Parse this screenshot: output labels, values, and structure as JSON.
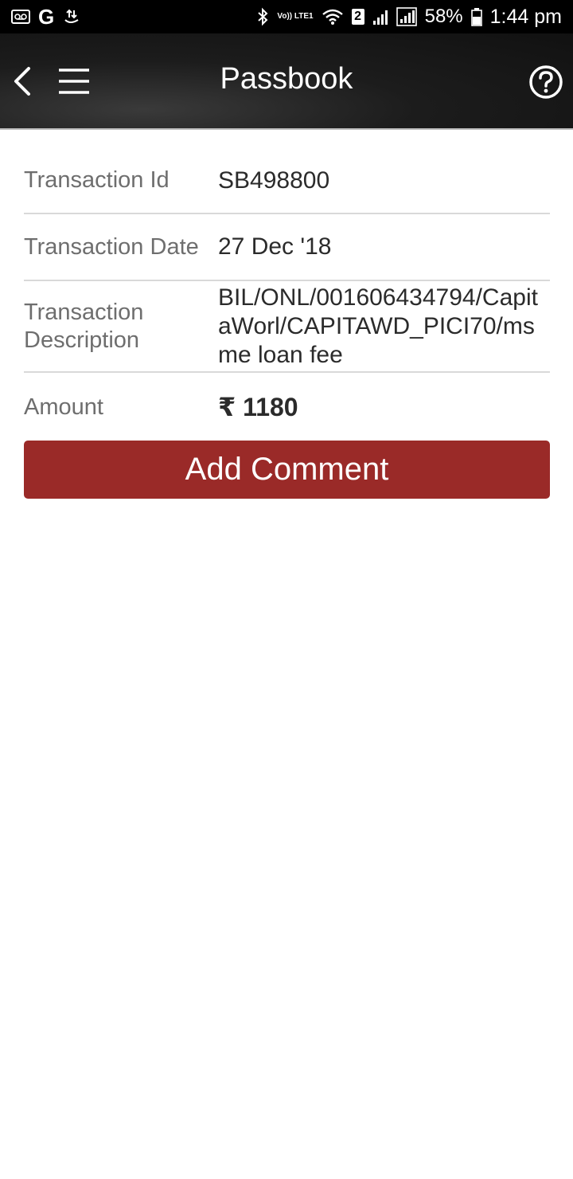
{
  "status_bar": {
    "battery_percent": "58%",
    "time": "1:44 pm",
    "volte_label": "Vo)) LTE1",
    "sim_label": "2",
    "g_label": "G",
    "icons": [
      "voicemail-icon",
      "google-icon",
      "data-transfer-icon",
      "bluetooth-icon",
      "volte-icon",
      "wifi-icon",
      "sim-2-icon",
      "signal-weak-icon",
      "signal-icon",
      "battery-icon"
    ]
  },
  "app_bar": {
    "title": "Passbook",
    "icons": [
      "back-arrow-icon",
      "hamburger-menu-icon",
      "help-circle-icon"
    ]
  },
  "transaction": {
    "id_label": "Transaction Id",
    "id_value": "SB498800",
    "date_label": "Transaction Date",
    "date_value": "27 Dec '18",
    "description_label": "Transaction Description",
    "description_value": "BIL/ONL/001606434794/CapitaWorl/CAPITAWD_PICI70/msme loan fee",
    "amount_label": "Amount",
    "amount_value": "₹ 1180"
  },
  "actions": {
    "add_comment_label": "Add Comment"
  },
  "colors": {
    "accent": "#9a2a28",
    "status_bar_bg": "#000000",
    "app_bar_bg": "#1c1c1c",
    "label_text": "#6e6e6e",
    "value_text": "#2b2b2b",
    "divider": "#d9d9d9"
  }
}
